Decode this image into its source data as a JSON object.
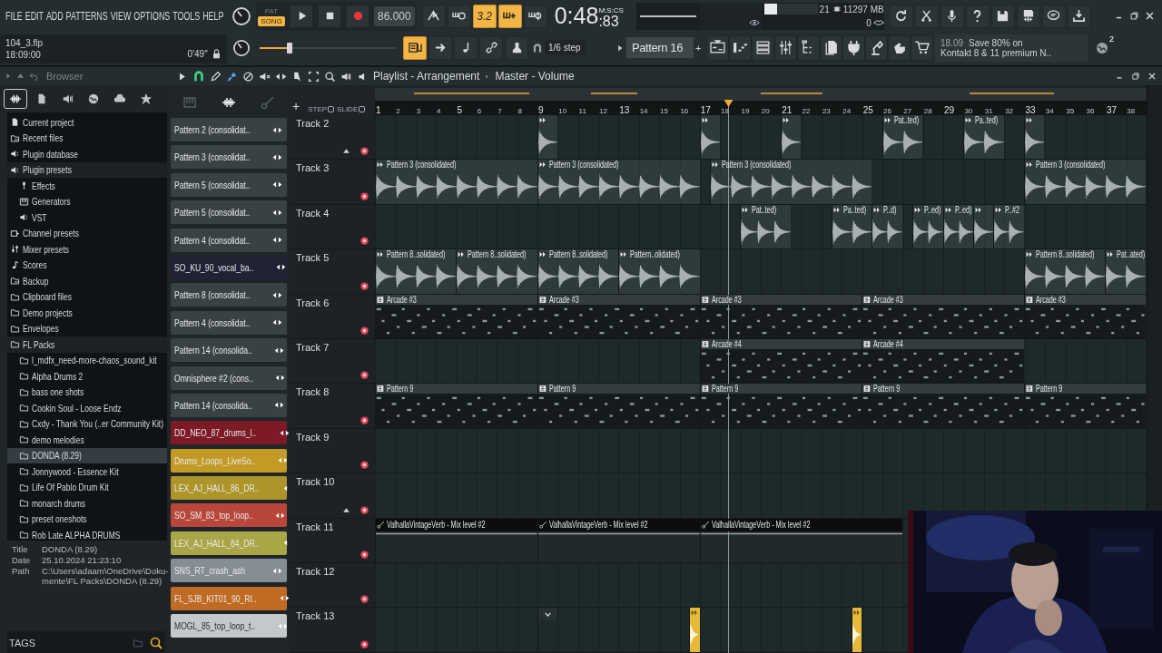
{
  "menu": [
    "FILE",
    "EDIT",
    "ADD",
    "PATTERNS",
    "VIEW",
    "OPTIONS",
    "TOOLS",
    "HELP"
  ],
  "project": {
    "file": "104_3.flp",
    "time": "18:09:00",
    "length": "0'49''"
  },
  "modes": [
    {
      "label": "PAT",
      "selected": false
    },
    {
      "label": "SONG",
      "selected": true
    }
  ],
  "tempo": "86.000",
  "master_volume": {
    "level": 0.22
  },
  "toggles_top": [
    {
      "on": false
    },
    {
      "on": false
    },
    {
      "on": true,
      "label": "3.2"
    },
    {
      "on": true
    },
    {
      "on": false
    }
  ],
  "toggles_bottom": [
    {
      "on": true
    },
    {
      "on": false
    },
    {
      "on": false
    },
    {
      "on": false
    },
    {
      "on": false
    }
  ],
  "time": {
    "main": "0:48",
    "centiseconds": ":83",
    "format": "M:S:CS"
  },
  "cpu": {
    "level": 0.25,
    "reading": "21"
  },
  "memory": "11297 MB",
  "polyphony": "0",
  "snap": "1/6 step",
  "pattern": {
    "name": "Pattern 16",
    "add": "+"
  },
  "news": {
    "date": "18.09",
    "line1": "Save 80% on",
    "line2": "Kontakt 8 & 11 premium N..",
    "badge": "2"
  },
  "browser": {
    "title": "Browser",
    "tabs": [
      {
        "selected": true
      },
      {
        "selected": false
      },
      {
        "selected": false
      },
      {
        "selected": false
      },
      {
        "selected": false
      },
      {
        "selected": false
      }
    ],
    "tree": [
      {
        "label": "Current project",
        "kind": "project",
        "selected": false
      },
      {
        "label": "Recent files",
        "kind": "history",
        "selected": false
      },
      {
        "label": "Plugin database",
        "kind": "plugin",
        "selected": false
      },
      {
        "label": "Plugin presets",
        "kind": "plugin",
        "selected": false,
        "expanded": true,
        "children": [
          {
            "label": "Effects",
            "kind": "effect",
            "selected": false
          },
          {
            "label": "Generators",
            "kind": "generator",
            "selected": false
          },
          {
            "label": "VST",
            "kind": "plugin",
            "selected": false
          }
        ]
      },
      {
        "label": "Channel presets",
        "kind": "channel",
        "selected": false
      },
      {
        "label": "Mixer presets",
        "kind": "mixer",
        "selected": false
      },
      {
        "label": "Scores",
        "kind": "score",
        "selected": false
      },
      {
        "label": "Backup",
        "kind": "history",
        "selected": false
      },
      {
        "label": "Clipboard files",
        "kind": "folder",
        "selected": false
      },
      {
        "label": "Demo projects",
        "kind": "folder",
        "selected": false
      },
      {
        "label": "Envelopes",
        "kind": "folder",
        "selected": false
      },
      {
        "label": "FL Packs",
        "kind": "folder",
        "selected": false,
        "expanded": true,
        "children": [
          {
            "label": "l_mdfx_need-more-chaos_sound_kit",
            "kind": "folder",
            "selected": false
          },
          {
            "label": "Alpha Drums 2",
            "kind": "folder",
            "selected": false
          },
          {
            "label": "bass one shots",
            "kind": "folder",
            "selected": false
          },
          {
            "label": "Cookin Soul - Loose Endz",
            "kind": "folder",
            "selected": false
          },
          {
            "label": "Cxdy - Thank You (..er Community Kit)",
            "kind": "folder",
            "selected": false
          },
          {
            "label": "demo melodies",
            "kind": "folder",
            "selected": false
          },
          {
            "label": "DONDA (8.29)",
            "kind": "folder",
            "selected": true
          },
          {
            "label": "Jonnywood - Essence Kit",
            "kind": "folder",
            "selected": false
          },
          {
            "label": "Life Of Pablo Drum Kit",
            "kind": "folder",
            "selected": false
          },
          {
            "label": "monarch drums",
            "kind": "folder",
            "selected": false
          },
          {
            "label": "preset oneshots",
            "kind": "folder",
            "selected": false
          },
          {
            "label": "Rob Late ALPHA DRUMS",
            "kind": "folder",
            "selected": false
          }
        ]
      }
    ],
    "info": [
      {
        "label": "Title",
        "value": [
          "DONDA (8.29)"
        ]
      },
      {
        "label": "Date",
        "value": [
          "25.10.2024 21:23:10"
        ]
      },
      {
        "label": "Path",
        "value": [
          "C:\\Users\\adaam\\OneDrive\\Doku-",
          "mente\\FL Packs\\DONDA (8.29)"
        ]
      }
    ],
    "tags": "TAGS"
  },
  "playlist": {
    "title": "Playlist - Arrangement",
    "target": "Master - Volume",
    "step": "STEP",
    "slide": "SLIDE",
    "add": "+",
    "picker_tabs": [
      {
        "selected": false
      },
      {
        "selected": true
      },
      {
        "selected": false
      }
    ],
    "channels": [
      {
        "name": "Pattern 2 (consolidat..",
        "color": "#3a4145"
      },
      {
        "name": "Pattern 3 (consolidat..",
        "color": "#3a4145"
      },
      {
        "name": "Pattern 5 (consolidat..",
        "color": "#3a4145"
      },
      {
        "name": "Pattern 5 (consolidat..",
        "color": "#3a4145"
      },
      {
        "name": "Pattern 4 (consolidat..",
        "color": "#3a4145"
      },
      {
        "name": "SO_KU_90_vocal_ba..",
        "color": "#1f2334"
      },
      {
        "name": "Pattern 8 (consolidat..",
        "color": "#3a4145"
      },
      {
        "name": "Pattern 4 (consolidat..",
        "color": "#3a4145"
      },
      {
        "name": "Pattern 14 (consolida..",
        "color": "#3a4145"
      },
      {
        "name": "Omnisphere #2 (cons..",
        "color": "#3a4145"
      },
      {
        "name": "Pattern 14 (consolida..",
        "color": "#3a4145"
      },
      {
        "name": "DD_NEO_87_drums_l..",
        "color": "#7c1a26"
      },
      {
        "name": "Drums_Loops_LiveSo..",
        "color": "#c29a25"
      },
      {
        "name": "LEX_AJ_HALL_86_DR..",
        "color": "#ad952a"
      },
      {
        "name": "SO_SM_83_top_loop..",
        "color": "#b8473a"
      },
      {
        "name": "LEX_AJ_HALL_84_DR..",
        "color": "#a9a647"
      },
      {
        "name": "SNS_RT_crash_ash",
        "color": "#878d94"
      },
      {
        "name": "FL_SJB_KIT01_90_RI..",
        "color": "#c06a24"
      },
      {
        "name": "MOGL_85_top_loop_t..",
        "color": "#c5c8cb"
      }
    ],
    "bars": [
      "1",
      "2",
      "3",
      "4",
      "5",
      "6",
      "7",
      "8",
      "9",
      "10",
      "11",
      "12",
      "13",
      "14",
      "15",
      "16",
      "17",
      "18",
      "19",
      "20",
      "21",
      "22",
      "23",
      "24",
      "25",
      "26",
      "27",
      "28",
      "29",
      "30",
      "31",
      "32",
      "33",
      "34",
      "35",
      "36",
      "37",
      "38"
    ],
    "playhead": {
      "level": 0.458
    },
    "tracks": [
      {
        "name": "Track 2",
        "expanded": true,
        "clips": [
          {
            "kind": "audio"
          },
          {
            "kind": "audio"
          },
          {
            "kind": "audio"
          },
          {
            "kind": "audio",
            "label": "Pat..ted)"
          },
          {
            "kind": "audio",
            "label": "Pa..ted)"
          },
          {
            "kind": "audio"
          }
        ]
      },
      {
        "name": "Track 3",
        "expanded": false,
        "clips": [
          {
            "kind": "audio",
            "label": "Pattern 3 (consolidated)"
          },
          {
            "kind": "audio",
            "label": "Pattern 3 (consolidated)"
          },
          {
            "kind": "audio",
            "label": "Pattern 3 (consolidated)"
          },
          {
            "kind": "audio",
            "label": "Pattern 3 (consolidated)"
          }
        ]
      },
      {
        "name": "Track 4",
        "expanded": false,
        "clips": [
          {
            "kind": "audio",
            "label": "Pat..ted)"
          },
          {
            "kind": "audio",
            "label": "Pa..ted)"
          },
          {
            "kind": "audio",
            "label": "P..d)"
          },
          {
            "kind": "audio",
            "label": "P..ed)"
          },
          {
            "kind": "audio",
            "label": "P..ed)"
          },
          {
            "kind": "audio"
          },
          {
            "kind": "audio",
            "label": "P..#2"
          }
        ]
      },
      {
        "name": "Track 5",
        "expanded": false,
        "clips": [
          {
            "kind": "audio",
            "label": "Pattern 8..solidated)"
          },
          {
            "kind": "audio",
            "label": "Pattern 8..solidated)"
          },
          {
            "kind": "audio",
            "label": "Pattern 8..solidated)"
          },
          {
            "kind": "audio",
            "label": "Pattern..olidated)"
          },
          {
            "kind": "audio",
            "label": "Pattern 8..solidated)"
          },
          {
            "kind": "audio",
            "label": "Pat..ated)"
          }
        ]
      },
      {
        "name": "Track 6",
        "expanded": false,
        "clips": [
          {
            "kind": "pattern",
            "label": "Arcade #3"
          },
          {
            "kind": "pattern",
            "label": "Arcade #3"
          },
          {
            "kind": "pattern",
            "label": "Arcade #3"
          },
          {
            "kind": "pattern",
            "label": "Arcade #3"
          },
          {
            "kind": "pattern",
            "label": "Arcade #3"
          }
        ]
      },
      {
        "name": "Track 7",
        "expanded": false,
        "clips": [
          {
            "kind": "pattern",
            "label": "Arcade #4"
          },
          {
            "kind": "pattern",
            "label": "Arcade #4"
          }
        ]
      },
      {
        "name": "Track 8",
        "expanded": false,
        "clips": [
          {
            "kind": "pattern",
            "label": "Pattern 9"
          },
          {
            "kind": "pattern",
            "label": "Pattern 9"
          },
          {
            "kind": "pattern",
            "label": "Pattern 9"
          },
          {
            "kind": "pattern",
            "label": "Pattern 9"
          },
          {
            "kind": "pattern",
            "label": "Pattern 9"
          }
        ]
      },
      {
        "name": "Track 9",
        "expanded": false
      },
      {
        "name": "Track 10",
        "expanded": true
      },
      {
        "name": "Track 11",
        "expanded": false,
        "clips": [
          {
            "kind": "automation",
            "label": "ValhallaVintageVerb - Mix level #2"
          },
          {
            "kind": "automation",
            "label": "ValhallaVintageVerb - Mix level #2"
          },
          {
            "kind": "automation",
            "label": "ValhallaVintageVerb - Mix level #2"
          }
        ]
      },
      {
        "name": "Track 12",
        "expanded": false
      },
      {
        "name": "Track 13",
        "expanded": false,
        "clips": [
          {
            "kind": "marker"
          },
          {
            "kind": "audio",
            "color": "#e6b93a"
          },
          {
            "kind": "audio",
            "color": "#e6b93a"
          }
        ]
      }
    ]
  }
}
